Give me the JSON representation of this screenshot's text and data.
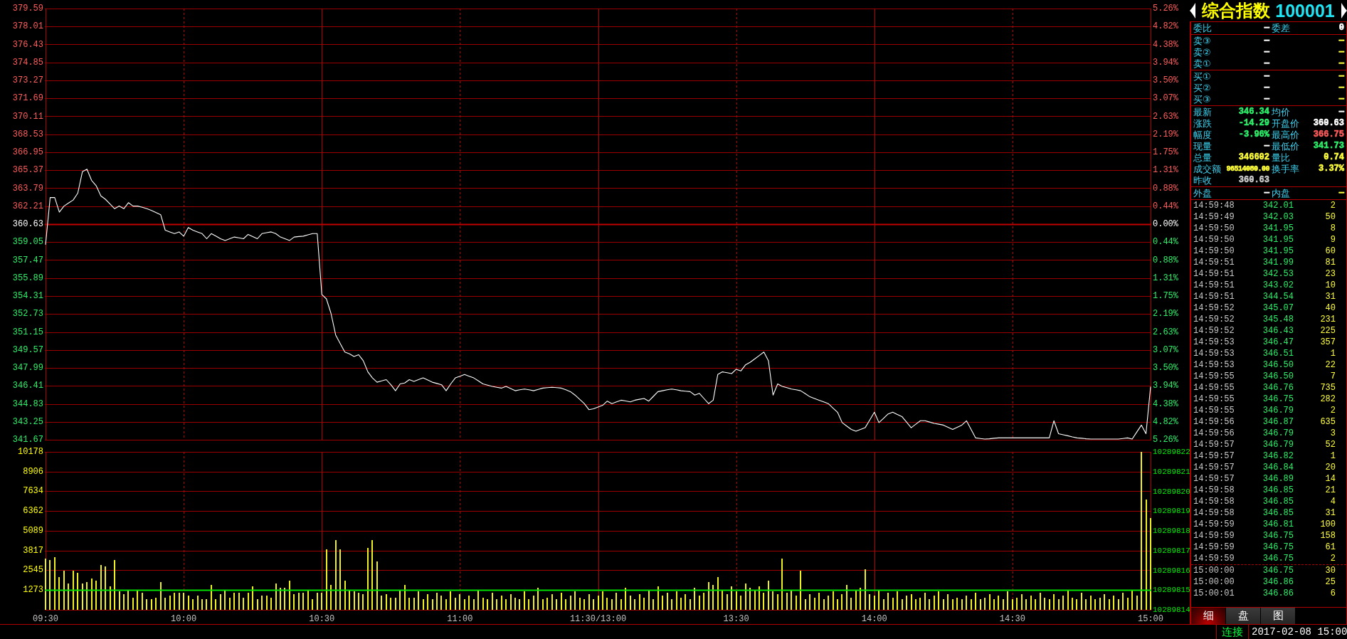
{
  "price_chart": {
    "right_axis_labels": [
      "5.26%",
      "4.82%",
      "4.38%",
      "3.94%",
      "3.50%",
      "3.07%",
      "2.63%",
      "2.19%",
      "1.75%",
      "1.31%",
      "0.88%",
      "0.44%",
      "0.00%",
      "0.44%",
      "0.88%",
      "1.31%",
      "1.75%",
      "2.19%",
      "2.63%",
      "3.07%",
      "3.50%",
      "3.94%",
      "4.38%",
      "4.82%",
      "5.26%"
    ],
    "chart_data": {
      "type": "line",
      "grid": true,
      "categories": [
        null,
        null,
        null,
        null,
        null,
        null,
        null,
        null,
        null,
        null,
        null,
        null,
        null,
        null,
        null,
        null,
        null,
        null,
        null,
        null,
        null,
        null,
        null,
        null,
        null,
        null,
        null,
        null,
        null,
        null,
        null,
        null,
        null,
        null,
        null,
        null,
        null,
        null,
        null,
        null,
        null,
        null,
        null,
        null,
        null,
        null,
        null,
        null,
        null,
        null,
        null,
        null,
        null,
        null,
        null,
        null,
        null,
        null,
        null,
        null,
        null,
        null,
        null,
        null,
        null,
        null,
        null,
        null,
        null,
        null,
        null,
        null,
        null,
        null,
        null,
        null,
        null,
        null,
        null,
        null,
        null,
        null,
        null,
        null,
        null,
        null,
        null,
        null,
        null,
        null,
        null,
        null,
        null,
        null,
        null,
        null,
        null,
        null,
        null,
        null,
        null,
        null,
        null,
        null,
        null,
        null,
        null,
        null,
        null,
        null,
        null,
        null,
        null,
        null,
        null,
        null,
        null,
        null,
        null,
        null,
        null,
        null,
        null,
        null,
        null,
        null,
        null,
        null,
        null,
        null,
        null,
        null,
        null,
        null,
        null,
        null,
        null,
        null,
        null,
        null,
        null,
        null,
        null,
        null,
        null,
        null,
        null,
        null,
        null,
        null,
        null,
        null,
        null,
        null,
        null,
        null,
        null,
        null,
        null,
        null,
        null,
        null,
        null,
        null,
        null,
        null,
        null,
        null,
        null,
        null,
        null,
        null,
        null,
        null,
        null,
        null,
        null,
        null,
        null,
        null,
        null,
        null,
        null,
        null,
        null,
        null,
        null,
        null,
        null,
        null,
        null,
        null,
        null,
        null,
        null,
        null,
        null,
        null,
        null,
        null,
        null,
        null,
        null,
        null,
        null,
        null,
        null,
        null,
        null,
        null,
        null,
        null,
        null,
        null,
        null,
        null,
        null,
        null,
        null,
        null,
        null,
        null,
        null,
        null,
        null,
        null,
        null,
        null,
        null,
        null,
        null,
        null,
        null,
        null,
        null,
        null,
        null,
        null,
        null,
        null,
        null
      ],
      "values": [
        358.82,
        362.97,
        362.97,
        361.69,
        362.22,
        362.49,
        362.75,
        363.35,
        365.24,
        365.47,
        364.48,
        364.0,
        363.12,
        362.82,
        362.41,
        361.99,
        362.22,
        361.99,
        362.52,
        362.22,
        362.22,
        362.11,
        361.99,
        361.84,
        361.65,
        361.46,
        360.1,
        359.95,
        359.8,
        359.95,
        359.57,
        360.33,
        360.1,
        359.95,
        359.8,
        359.35,
        359.8,
        359.58,
        359.35,
        359.2,
        359.35,
        359.5,
        359.43,
        359.35,
        359.73,
        359.54,
        359.35,
        359.8,
        359.88,
        359.95,
        359.8,
        359.5,
        359.35,
        359.2,
        359.5,
        359.54,
        359.57,
        359.69,
        359.8,
        359.8,
        354.44,
        354.06,
        352.78,
        350.89,
        350.13,
        349.38,
        349.23,
        349.0,
        349.15,
        348.62,
        347.64,
        347.11,
        346.73,
        346.85,
        346.96,
        346.51,
        345.98,
        346.58,
        346.66,
        346.96,
        346.81,
        346.96,
        347.11,
        346.92,
        346.73,
        346.62,
        346.51,
        345.98,
        346.58,
        347.11,
        347.26,
        347.41,
        347.26,
        347.11,
        346.85,
        346.58,
        346.47,
        346.36,
        346.29,
        346.21,
        346.36,
        346.17,
        345.98,
        346.06,
        346.13,
        346.06,
        345.98,
        346.1,
        346.21,
        346.25,
        346.28,
        346.25,
        346.21,
        346.06,
        345.9,
        345.6,
        345.23,
        344.85,
        344.32,
        344.39,
        344.55,
        344.7,
        345.07,
        344.85,
        345.0,
        345.15,
        345.08,
        345.0,
        345.15,
        345.23,
        345.3,
        345.07,
        345.49,
        345.9,
        345.98,
        346.06,
        346.13,
        346.06,
        345.98,
        345.94,
        345.9,
        345.6,
        345.75,
        345.3,
        344.85,
        345.15,
        347.41,
        347.64,
        347.57,
        347.49,
        347.87,
        347.72,
        348.25,
        348.47,
        348.77,
        349.08,
        349.38,
        348.62,
        345.6,
        346.58,
        346.36,
        346.25,
        346.13,
        346.06,
        345.98,
        345.72,
        345.45,
        345.3,
        345.15,
        345.0,
        344.85,
        344.47,
        344.09,
        343.18,
        342.88,
        342.58,
        342.43,
        342.58,
        342.73,
        343.41,
        344.09,
        343.18,
        343.56,
        343.94,
        344.09,
        343.9,
        343.71,
        343.22,
        342.73,
        343.04,
        343.34,
        343.34,
        343.23,
        343.11,
        343.04,
        342.96,
        342.77,
        342.58,
        342.77,
        342.96,
        343.34,
        342.59,
        341.83,
        341.78,
        341.73,
        341.76,
        341.8,
        341.83,
        341.83,
        341.83,
        341.83,
        341.83,
        341.83,
        341.83,
        341.83,
        341.83,
        341.83,
        341.83,
        341.83,
        343.34,
        342.2,
        342.11,
        342.02,
        341.92,
        341.83,
        341.8,
        341.76,
        341.73,
        341.73,
        341.73,
        341.73,
        341.73,
        341.73,
        341.73,
        341.78,
        341.83,
        341.73,
        342.35,
        342.96,
        342.2,
        346.34
      ],
      "ylim": [
        341.67,
        379.59
      ],
      "yticks": [
        379.59,
        378.01,
        376.43,
        374.85,
        373.27,
        371.69,
        370.11,
        368.53,
        366.95,
        365.37,
        363.79,
        362.21,
        360.63,
        359.05,
        357.47,
        355.89,
        354.31,
        352.73,
        351.15,
        349.57,
        347.99,
        346.41,
        344.83,
        343.25,
        341.67
      ],
      "ref_lines": [
        {
          "axis": "y",
          "value": 360.63,
          "color": "#c00000"
        }
      ]
    }
  },
  "volume_chart": {
    "right_axis_labels": [
      "10289822",
      "10289821",
      "10289820",
      "10289819",
      "10289818",
      "10289817",
      "10289816",
      "10289815",
      "10289814"
    ],
    "chart_data": {
      "type": "bar",
      "grid": true,
      "categories": [
        "09:30",
        null,
        null,
        null,
        null,
        null,
        null,
        null,
        null,
        null,
        null,
        null,
        null,
        null,
        null,
        null,
        null,
        null,
        null,
        null,
        null,
        null,
        null,
        null,
        null,
        null,
        null,
        null,
        null,
        null,
        "10:00",
        null,
        null,
        null,
        null,
        null,
        null,
        null,
        null,
        null,
        null,
        null,
        null,
        null,
        null,
        null,
        null,
        null,
        null,
        null,
        null,
        null,
        null,
        null,
        null,
        null,
        null,
        null,
        null,
        null,
        "10:30",
        null,
        null,
        null,
        null,
        null,
        null,
        null,
        null,
        null,
        null,
        null,
        null,
        null,
        null,
        null,
        null,
        null,
        null,
        null,
        null,
        null,
        null,
        null,
        null,
        null,
        null,
        null,
        null,
        null,
        "11:00",
        null,
        null,
        null,
        null,
        null,
        null,
        null,
        null,
        null,
        null,
        null,
        null,
        null,
        null,
        null,
        null,
        null,
        null,
        null,
        null,
        null,
        null,
        null,
        null,
        null,
        null,
        null,
        null,
        null,
        "11:30/13:00",
        null,
        null,
        null,
        null,
        null,
        null,
        null,
        null,
        null,
        null,
        null,
        null,
        null,
        null,
        null,
        null,
        null,
        null,
        null,
        null,
        null,
        null,
        null,
        null,
        null,
        null,
        null,
        null,
        null,
        "13:30",
        null,
        null,
        null,
        null,
        null,
        null,
        null,
        null,
        null,
        null,
        null,
        null,
        null,
        null,
        null,
        null,
        null,
        null,
        null,
        null,
        null,
        null,
        null,
        null,
        null,
        null,
        null,
        null,
        null,
        "14:00",
        null,
        null,
        null,
        null,
        null,
        null,
        null,
        null,
        null,
        null,
        null,
        null,
        null,
        null,
        null,
        null,
        null,
        null,
        null,
        null,
        null,
        null,
        null,
        null,
        null,
        null,
        null,
        null,
        null,
        "14:30",
        null,
        null,
        null,
        null,
        null,
        null,
        null,
        null,
        null,
        null,
        null,
        null,
        null,
        null,
        null,
        null,
        null,
        null,
        null,
        null,
        null,
        null,
        null,
        null,
        null,
        null,
        null,
        null,
        null,
        "15:00"
      ],
      "values": [
        3300,
        3200,
        3400,
        2100,
        2500,
        1700,
        2500,
        2400,
        1700,
        1800,
        2000,
        1900,
        2900,
        2800,
        1500,
        3200,
        1200,
        1000,
        1300,
        800,
        1300,
        1100,
        700,
        700,
        800,
        1800,
        800,
        900,
        1100,
        1100,
        1100,
        900,
        700,
        900,
        700,
        700,
        1600,
        700,
        1000,
        1300,
        800,
        1100,
        1100,
        800,
        1100,
        1500,
        700,
        900,
        900,
        800,
        1700,
        1400,
        1400,
        1900,
        1000,
        1100,
        1100,
        1300,
        700,
        1100,
        1100,
        3900,
        1600,
        4500,
        3900,
        1900,
        1300,
        1200,
        1100,
        1000,
        4000,
        4500,
        3100,
        900,
        1000,
        800,
        800,
        1300,
        1600,
        800,
        800,
        1200,
        700,
        1000,
        700,
        1100,
        900,
        700,
        1200,
        800,
        1000,
        700,
        900,
        700,
        1300,
        800,
        700,
        1100,
        700,
        900,
        700,
        1000,
        800,
        700,
        1200,
        700,
        900,
        1400,
        700,
        800,
        1000,
        700,
        1100,
        700,
        900,
        1200,
        800,
        700,
        1000,
        700,
        900,
        1200,
        800,
        700,
        1100,
        700,
        1400,
        900,
        700,
        1000,
        800,
        1300,
        700,
        1500,
        900,
        1100,
        700,
        1200,
        800,
        1000,
        700,
        1400,
        900,
        1100,
        1800,
        1600,
        2100,
        1300,
        1000,
        1500,
        1200,
        900,
        1700,
        1400,
        1300,
        1500,
        1100,
        1900,
        1200,
        1000,
        3300,
        1100,
        1300,
        900,
        2500,
        700,
        1000,
        800,
        1100,
        700,
        900,
        1200,
        700,
        1000,
        1600,
        800,
        1300,
        1400,
        2600,
        1000,
        900,
        1300,
        700,
        1100,
        800,
        1200,
        700,
        900,
        1000,
        700,
        800,
        1100,
        700,
        900,
        1200,
        700,
        1000,
        700,
        800,
        700,
        900,
        700,
        1100,
        700,
        800,
        1000,
        700,
        900,
        700,
        1200,
        700,
        800,
        1000,
        700,
        900,
        700,
        1100,
        800,
        700,
        1000,
        700,
        900,
        1300,
        800,
        700,
        1100,
        700,
        900,
        700,
        800,
        1000,
        700,
        900,
        700,
        1100,
        800,
        1300,
        900,
        10178,
        7100,
        5900
      ],
      "ylim": [
        0,
        10178
      ],
      "yticks": [
        10178,
        8906,
        7634,
        6362,
        5089,
        3817,
        2545,
        1273
      ],
      "ref_lines": [
        {
          "axis": "y",
          "value": 1273,
          "color": "#00e000"
        }
      ]
    }
  },
  "quote_panel": {
    "title": {
      "name": "综合指数",
      "code": "100001"
    },
    "order_ratio": [
      {
        "label": "委比",
        "value": "—",
        "color": "#ffffff"
      },
      {
        "label": "委差",
        "value": "0",
        "color": "#ffffff"
      }
    ],
    "asks": [
      {
        "label": "卖③",
        "price": "—",
        "volume": "—"
      },
      {
        "label": "卖②",
        "price": "—",
        "volume": "—"
      },
      {
        "label": "卖①",
        "price": "—",
        "volume": "—"
      }
    ],
    "bids": [
      {
        "label": "买①",
        "price": "—",
        "volume": "—"
      },
      {
        "label": "买②",
        "price": "—",
        "volume": "—"
      },
      {
        "label": "买③",
        "price": "—",
        "volume": "—"
      }
    ],
    "stats": {
      "left": [
        {
          "label": "最新",
          "value": "346.34",
          "color": "#2cf06a"
        },
        {
          "label": "涨跌",
          "value": "-14.29",
          "color": "#2cf06a"
        },
        {
          "label": "幅度",
          "value": "-3.96%",
          "color": "#2cf06a"
        },
        {
          "label": "现量",
          "value": "—",
          "color": "#ffffff"
        },
        {
          "label": "总量",
          "value": "346602",
          "color": "#ffff3a"
        },
        {
          "label": "成交额",
          "value": "96514080.00",
          "color": "#ffff3a"
        },
        {
          "label": "昨收",
          "value": "360.63",
          "color": "#c8c8c8"
        }
      ],
      "right": [
        {
          "label": "均价",
          "value": "—",
          "color": "#ffffff"
        },
        {
          "label": "开盘价",
          "value": "360.63",
          "color": "#ffffff"
        },
        {
          "label": "最高价",
          "value": "366.75",
          "color": "#ff5c5c"
        },
        {
          "label": "最低价",
          "value": "341.73",
          "color": "#2cf06a"
        },
        {
          "label": "量比",
          "value": "0.74",
          "color": "#ffff3a"
        },
        {
          "label": "换手率",
          "value": "3.37%",
          "color": "#ffff3a"
        }
      ]
    },
    "flow": [
      {
        "label": "外盘",
        "value": "—",
        "color": "#ffffff"
      },
      {
        "label": "内盘",
        "value": "—",
        "color": "#ffff3a"
      }
    ],
    "trade_blocks": [
      [
        {
          "time": "14:59:48",
          "price": "342.01",
          "volume": "2"
        },
        {
          "time": "14:59:49",
          "price": "342.03",
          "volume": "50"
        },
        {
          "time": "14:59:50",
          "price": "341.95",
          "volume": "8"
        },
        {
          "time": "14:59:50",
          "price": "341.95",
          "volume": "9"
        },
        {
          "time": "14:59:50",
          "price": "341.95",
          "volume": "60"
        },
        {
          "time": "14:59:51",
          "price": "341.99",
          "volume": "81"
        },
        {
          "time": "14:59:51",
          "price": "342.53",
          "volume": "23"
        },
        {
          "time": "14:59:51",
          "price": "343.02",
          "volume": "10"
        },
        {
          "time": "14:59:51",
          "price": "344.54",
          "volume": "31"
        },
        {
          "time": "14:59:52",
          "price": "345.07",
          "volume": "40"
        },
        {
          "time": "14:59:52",
          "price": "345.48",
          "volume": "231"
        },
        {
          "time": "14:59:52",
          "price": "346.43",
          "volume": "225"
        },
        {
          "time": "14:59:53",
          "price": "346.47",
          "volume": "357"
        },
        {
          "time": "14:59:53",
          "price": "346.51",
          "volume": "1"
        },
        {
          "time": "14:59:53",
          "price": "346.50",
          "volume": "22"
        },
        {
          "time": "14:59:55",
          "price": "346.50",
          "volume": "7"
        },
        {
          "time": "14:59:55",
          "price": "346.76",
          "volume": "735"
        },
        {
          "time": "14:59:55",
          "price": "346.75",
          "volume": "282"
        },
        {
          "time": "14:59:55",
          "price": "346.79",
          "volume": "2"
        },
        {
          "time": "14:59:56",
          "price": "346.87",
          "volume": "635"
        },
        {
          "time": "14:59:56",
          "price": "346.79",
          "volume": "3"
        },
        {
          "time": "14:59:57",
          "price": "346.79",
          "volume": "52"
        },
        {
          "time": "14:59:57",
          "price": "346.82",
          "volume": "1"
        },
        {
          "time": "14:59:57",
          "price": "346.84",
          "volume": "20"
        },
        {
          "time": "14:59:57",
          "price": "346.89",
          "volume": "14"
        },
        {
          "time": "14:59:58",
          "price": "346.85",
          "volume": "21"
        },
        {
          "time": "14:59:58",
          "price": "346.85",
          "volume": "4"
        },
        {
          "time": "14:59:58",
          "price": "346.85",
          "volume": "31"
        },
        {
          "time": "14:59:59",
          "price": "346.81",
          "volume": "100"
        },
        {
          "time": "14:59:59",
          "price": "346.75",
          "volume": "158"
        },
        {
          "time": "14:59:59",
          "price": "346.75",
          "volume": "61"
        },
        {
          "time": "14:59:59",
          "price": "346.75",
          "volume": "2"
        }
      ],
      [
        {
          "time": "15:00:00",
          "price": "346.75",
          "volume": "30"
        },
        {
          "time": "15:00:00",
          "price": "346.86",
          "volume": "25"
        },
        {
          "time": "15:00:01",
          "price": "346.86",
          "volume": "6"
        }
      ]
    ],
    "tabs": [
      {
        "label": "细",
        "selected": true
      },
      {
        "label": "盘",
        "selected": false
      },
      {
        "label": "图",
        "selected": false
      }
    ]
  },
  "status_bar": {
    "connection": "连接",
    "datetime": "2017-02-08 15:00"
  }
}
